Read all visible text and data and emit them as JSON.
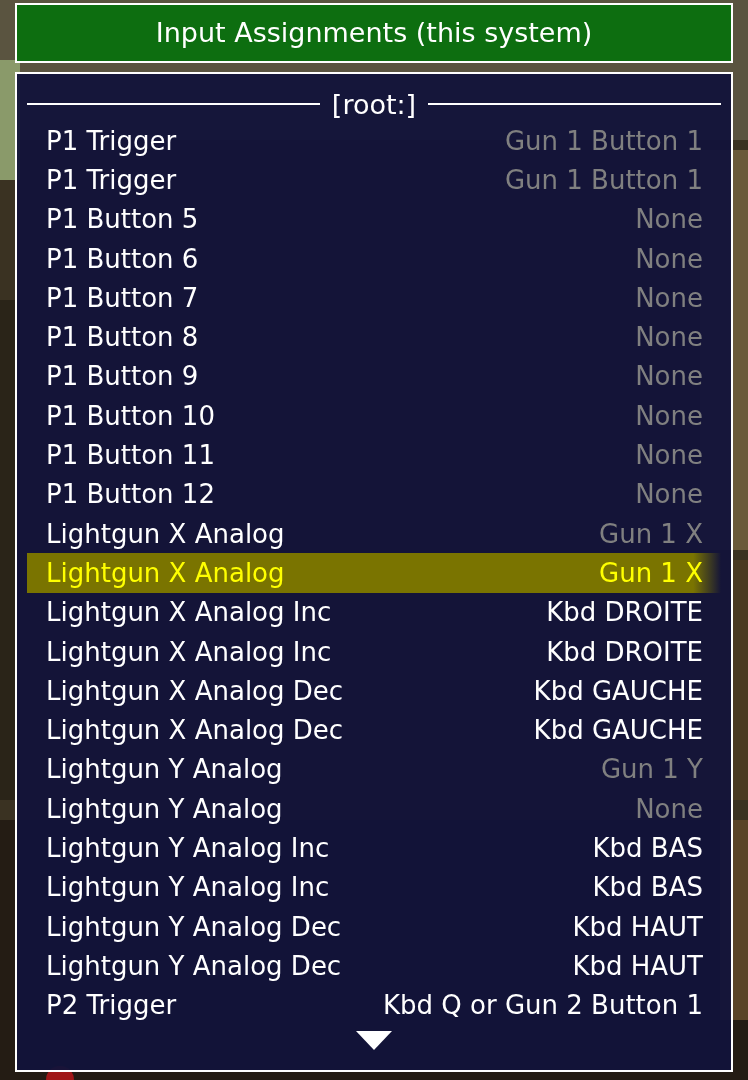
{
  "title": "Input Assignments (this system)",
  "section": "[root:]",
  "rows": [
    {
      "name": "P1 Trigger",
      "value": "Gun 1 Button 1",
      "dimmed": true,
      "selected": false
    },
    {
      "name": "P1 Trigger",
      "value": "Gun 1 Button 1",
      "dimmed": true,
      "selected": false
    },
    {
      "name": "P1 Button 5",
      "value": "None",
      "dimmed": true,
      "selected": false
    },
    {
      "name": "P1 Button 6",
      "value": "None",
      "dimmed": true,
      "selected": false
    },
    {
      "name": "P1 Button 7",
      "value": "None",
      "dimmed": true,
      "selected": false
    },
    {
      "name": "P1 Button 8",
      "value": "None",
      "dimmed": true,
      "selected": false
    },
    {
      "name": "P1 Button 9",
      "value": "None",
      "dimmed": true,
      "selected": false
    },
    {
      "name": "P1 Button 10",
      "value": "None",
      "dimmed": true,
      "selected": false
    },
    {
      "name": "P1 Button 11",
      "value": "None",
      "dimmed": true,
      "selected": false
    },
    {
      "name": "P1 Button 12",
      "value": "None",
      "dimmed": true,
      "selected": false
    },
    {
      "name": "Lightgun X Analog",
      "value": "Gun 1 X",
      "dimmed": true,
      "selected": false
    },
    {
      "name": "Lightgun X Analog",
      "value": "Gun 1 X",
      "dimmed": false,
      "selected": true
    },
    {
      "name": "Lightgun X Analog Inc",
      "value": "Kbd DROITE",
      "dimmed": false,
      "selected": false
    },
    {
      "name": "Lightgun X Analog Inc",
      "value": "Kbd DROITE",
      "dimmed": false,
      "selected": false
    },
    {
      "name": "Lightgun X Analog Dec",
      "value": "Kbd GAUCHE",
      "dimmed": false,
      "selected": false
    },
    {
      "name": "Lightgun X Analog Dec",
      "value": "Kbd GAUCHE",
      "dimmed": false,
      "selected": false
    },
    {
      "name": "Lightgun Y Analog",
      "value": "Gun 1 Y",
      "dimmed": true,
      "selected": false
    },
    {
      "name": "Lightgun Y Analog",
      "value": "None",
      "dimmed": true,
      "selected": false
    },
    {
      "name": "Lightgun Y Analog Inc",
      "value": "Kbd BAS",
      "dimmed": false,
      "selected": false
    },
    {
      "name": "Lightgun Y Analog Inc",
      "value": "Kbd BAS",
      "dimmed": false,
      "selected": false
    },
    {
      "name": "Lightgun Y Analog Dec",
      "value": "Kbd HAUT",
      "dimmed": false,
      "selected": false
    },
    {
      "name": "Lightgun Y Analog Dec",
      "value": "Kbd HAUT",
      "dimmed": false,
      "selected": false
    },
    {
      "name": "P2 Trigger",
      "value": "Kbd Q or Gun 2 Button 1",
      "dimmed": false,
      "selected": false
    }
  ]
}
